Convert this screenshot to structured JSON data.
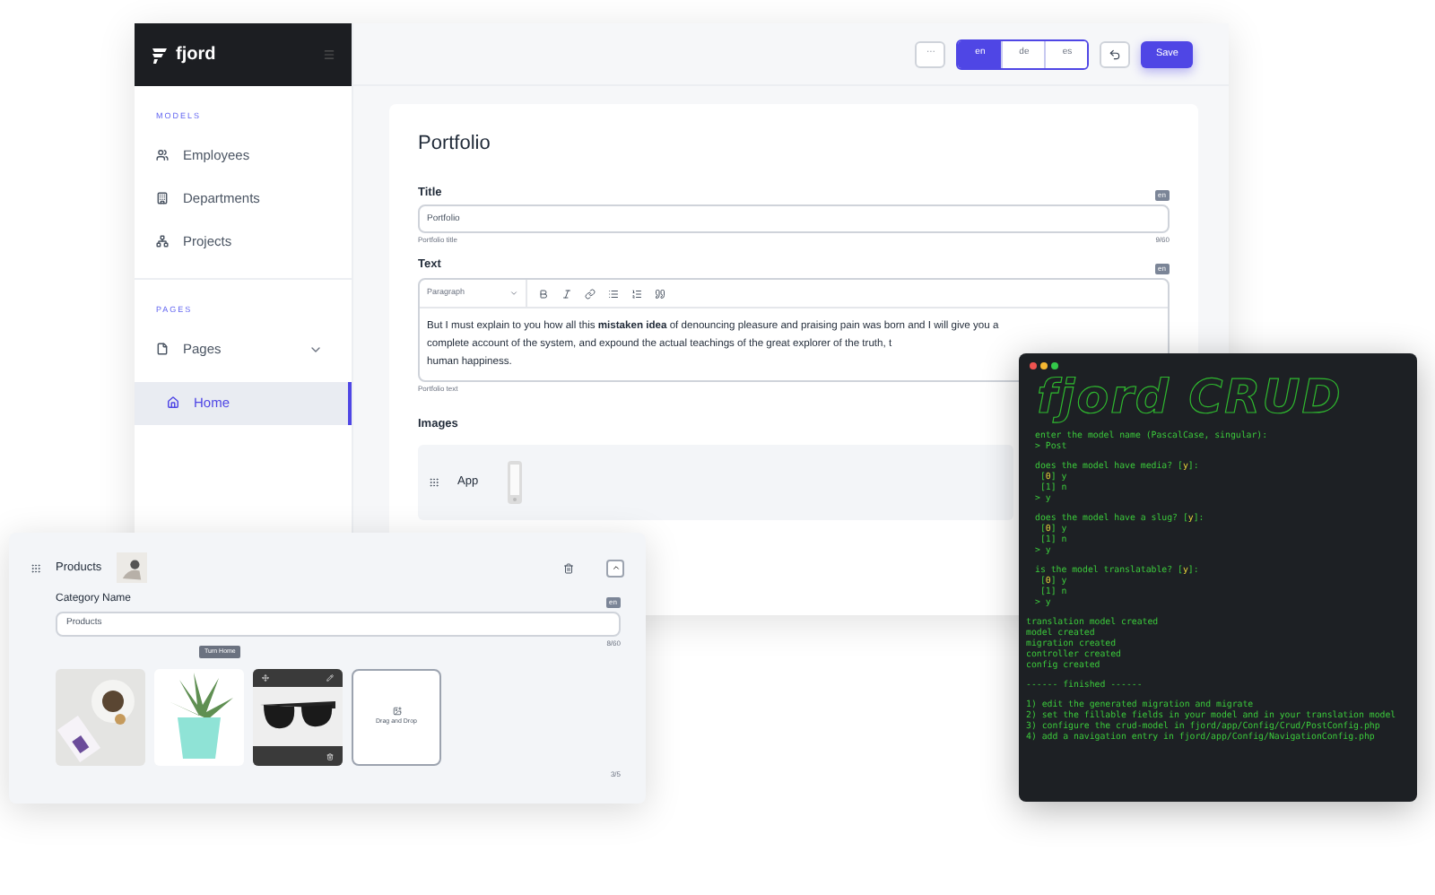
{
  "sidebar": {
    "logo": "fjord",
    "sections": [
      {
        "title": "MODELS",
        "items": [
          {
            "label": "Employees",
            "selected": false
          },
          {
            "label": "Departments",
            "selected": false
          },
          {
            "label": "Projects",
            "selected": false
          }
        ]
      },
      {
        "title": "PAGES",
        "items": [
          {
            "label": "Pages",
            "selected": false,
            "expanded": true,
            "children": [
              {
                "label": "Home",
                "selected": true
              }
            ]
          }
        ]
      }
    ]
  },
  "toolbar": {
    "more": "···",
    "languages": [
      {
        "label": "en",
        "selected": true
      },
      {
        "label": "de",
        "selected": false
      },
      {
        "label": "es",
        "selected": false
      }
    ],
    "save": "Save"
  },
  "form": {
    "heading": "Portfolio",
    "title_field": {
      "label": "Title",
      "badge": "en",
      "value": "Portfolio",
      "hint": "Portfolio title",
      "counter": "9/60"
    },
    "text_field": {
      "label": "Text",
      "badge": "en",
      "format": "Paragraph",
      "hint": "Portfolio text",
      "lines": [
        "But I must explain to you how all this **mistaken idea** of denouncing pleasure and praising pain was born and I will give you a",
        "complete account of the system, and expound the actual teachings of the great explorer of the truth, t",
        "human happiness."
      ]
    },
    "images": {
      "label": "Images",
      "rows": [
        {
          "title": "App"
        }
      ]
    }
  },
  "products": {
    "title": "Products",
    "field": {
      "label": "Category Name",
      "badge": "en",
      "value": "Products",
      "counter": "8/60"
    },
    "tooltip": "Turn Home",
    "images": [
      {
        "kind": "picture",
        "toolbar": false
      },
      {
        "kind": "picture",
        "toolbar": false
      },
      {
        "kind": "picture",
        "toolbar": true
      },
      {
        "kind": "dropzone",
        "label": "Drag and Drop"
      }
    ],
    "counter": "3/5"
  },
  "terminal": {
    "logo": "fjord CRUD",
    "blocks": [
      [
        [
          {
            "t": "enter the model name (PascalCase, singular):"
          }
        ],
        [
          {
            "t": "> Post"
          }
        ]
      ],
      [
        [
          {
            "t": "does the model have media? ["
          },
          {
            "t": "y",
            "hl": true
          },
          {
            "t": "]:"
          }
        ],
        [
          {
            "t": " ["
          },
          {
            "t": "0",
            "hl": true
          },
          {
            "t": "] y"
          }
        ],
        [
          {
            "t": " [1] n"
          }
        ],
        [
          {
            "t": "> y"
          }
        ]
      ],
      [
        [
          {
            "t": "does the model have a slug? ["
          },
          {
            "t": "y",
            "hl": true
          },
          {
            "t": "]:"
          }
        ],
        [
          {
            "t": " ["
          },
          {
            "t": "0",
            "hl": true
          },
          {
            "t": "] y"
          }
        ],
        [
          {
            "t": " [1] n"
          }
        ],
        [
          {
            "t": "> y"
          }
        ]
      ],
      [
        [
          {
            "t": "is the model translatable? ["
          },
          {
            "t": "y",
            "hl": true
          },
          {
            "t": "]:"
          }
        ],
        [
          {
            "t": " ["
          },
          {
            "t": "0",
            "hl": true
          },
          {
            "t": "] y"
          }
        ],
        [
          {
            "t": " [1] n"
          }
        ],
        [
          {
            "t": "> y"
          }
        ]
      ],
      [
        [
          {
            "t": "translation model created"
          }
        ],
        [
          {
            "t": "model created"
          }
        ],
        [
          {
            "t": "migration created"
          }
        ],
        [
          {
            "t": "controller created"
          }
        ],
        [
          {
            "t": "config created"
          }
        ]
      ],
      [
        [
          {
            "t": "------ finished ------"
          }
        ]
      ],
      [
        [
          {
            "t": "1) edit the generated migration and migrate"
          }
        ],
        [
          {
            "t": "2) set the fillable fields in your model and in your translation model"
          }
        ],
        [
          {
            "t": "3) configure the crud-model in fjord/app/Config/Crud/PostConfig.php"
          }
        ],
        [
          {
            "t": "4) add a navigation entry in fjord/app/Config/NavigationConfig.php"
          }
        ]
      ]
    ]
  }
}
